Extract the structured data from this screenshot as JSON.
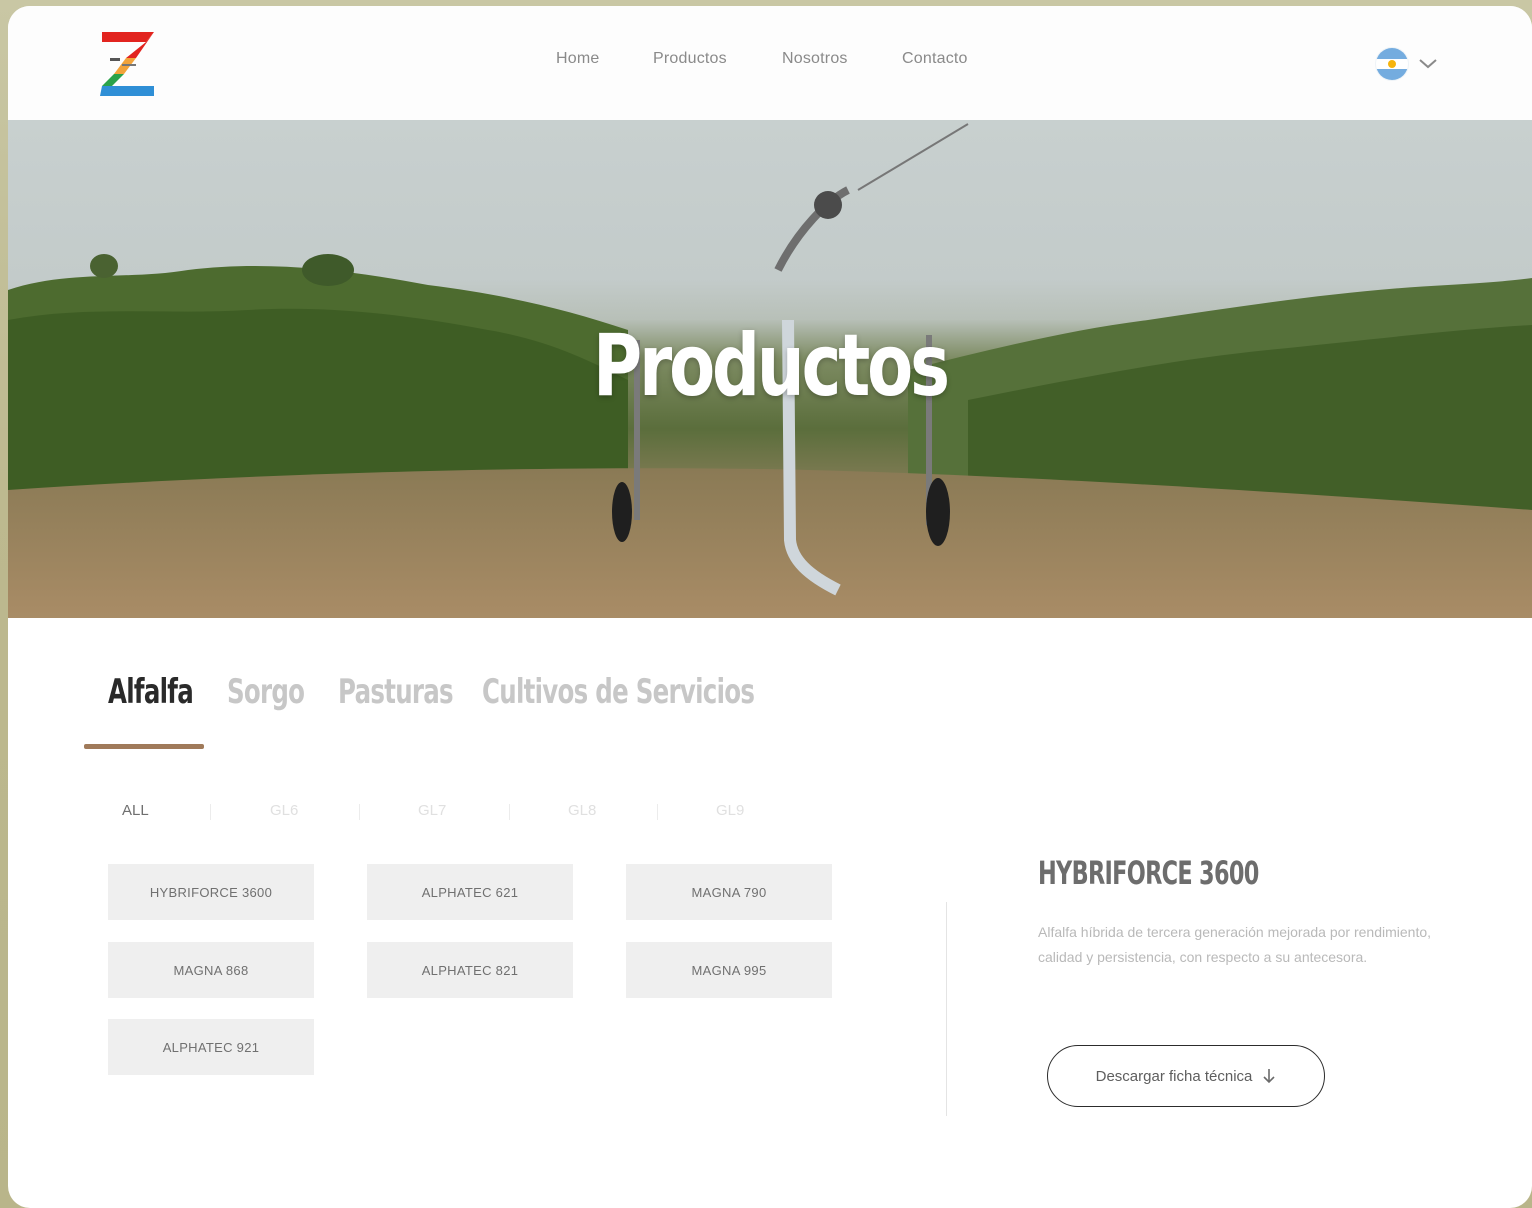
{
  "colors": {
    "accent_underline": "#a07a5a",
    "logo_red": "#e2241f",
    "logo_orange": "#f2a33a",
    "logo_green": "#2aa24a",
    "logo_blue": "#2f8fd6"
  },
  "header": {
    "logo_icon": "z-logo-icon",
    "nav": [
      {
        "label": "Home"
      },
      {
        "label": "Productos"
      },
      {
        "label": "Nosotros"
      },
      {
        "label": "Contacto"
      }
    ],
    "language": {
      "flag_icon": "argentina-flag-icon",
      "chevron_icon": "chevron-down-icon"
    }
  },
  "hero": {
    "title": "Productos"
  },
  "tabs": [
    {
      "label": "Alfalfa",
      "active": true
    },
    {
      "label": "Sorgo",
      "active": false
    },
    {
      "label": "Pasturas",
      "active": false
    },
    {
      "label": "Cultivos de Servicios",
      "active": false
    }
  ],
  "filters": [
    {
      "label": "ALL",
      "active": true
    },
    {
      "label": "GL6",
      "active": false
    },
    {
      "label": "GL7",
      "active": false
    },
    {
      "label": "GL8",
      "active": false
    },
    {
      "label": "GL9",
      "active": false
    }
  ],
  "products": [
    {
      "label": "HYBRIFORCE 3600"
    },
    {
      "label": "ALPHATEC 621"
    },
    {
      "label": "MAGNA 790"
    },
    {
      "label": "MAGNA 868"
    },
    {
      "label": "ALPHATEC 821"
    },
    {
      "label": "MAGNA 995"
    },
    {
      "label": "ALPHATEC 921"
    }
  ],
  "detail": {
    "title": "HYBRIFORCE 3600",
    "description": "Alfalfa híbrida de tercera generación mejorada por rendimiento, calidad y persistencia, con respecto a su antecesora.",
    "download_label": "Descargar ficha técnica",
    "download_icon": "arrow-down-icon"
  }
}
